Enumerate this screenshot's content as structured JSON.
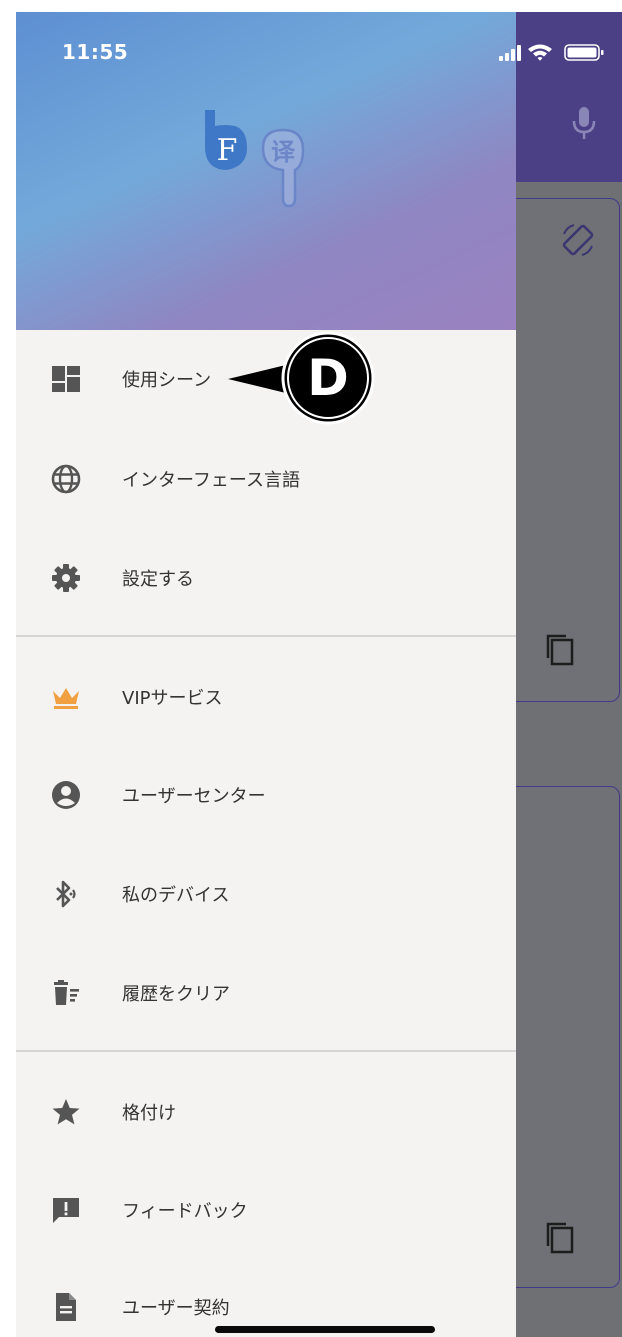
{
  "status_bar": {
    "time": "11:55"
  },
  "annotation": {
    "letter": "D"
  },
  "menu": {
    "items": [
      {
        "label": "使用シーン",
        "icon": "dashboard-icon"
      },
      {
        "label": "インターフェース言語",
        "icon": "globe-icon"
      },
      {
        "label": "設定する",
        "icon": "gear-icon"
      },
      {
        "label": "VIPサービス",
        "icon": "crown-icon"
      },
      {
        "label": "ユーザーセンター",
        "icon": "account-circle-icon"
      },
      {
        "label": "私のデバイス",
        "icon": "bluetooth-icon"
      },
      {
        "label": "履歴をクリア",
        "icon": "clear-history-icon"
      },
      {
        "label": "格付け",
        "icon": "star-icon"
      },
      {
        "label": "フィードバック",
        "icon": "feedback-icon"
      },
      {
        "label": "ユーザー契約",
        "icon": "document-icon"
      }
    ]
  },
  "colors": {
    "header_gradient": [
      "#5d8fd2",
      "#9a82c0"
    ],
    "drawer_bg": "#f4f3f2",
    "crown": "#f0a040",
    "app_header": "#4b3f86"
  }
}
